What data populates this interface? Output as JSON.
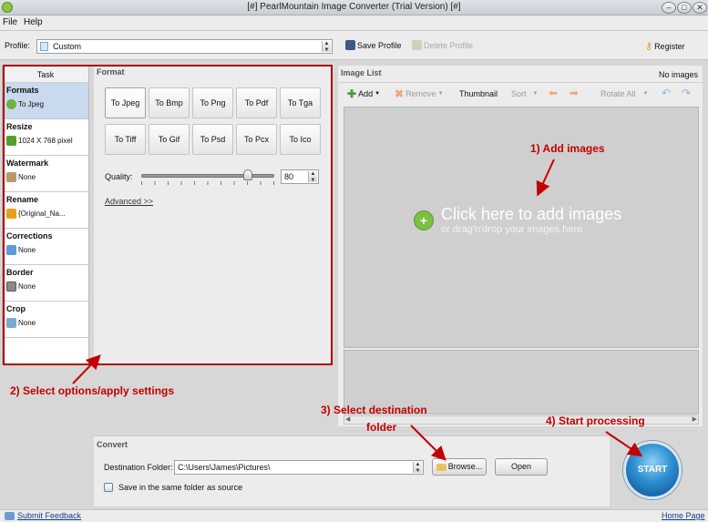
{
  "window": {
    "title": "[#] PearlMountain Image Converter (Trial Version) [#]"
  },
  "menu": {
    "file": "File",
    "help": "Help"
  },
  "profile": {
    "label": "Profile:",
    "value": "Custom",
    "save": "Save Profile",
    "delete": "Delete Profile",
    "register": "Register"
  },
  "task": {
    "header": "Task",
    "items": [
      {
        "title": "Formats",
        "value": "To Jpeg"
      },
      {
        "title": "Resize",
        "value": "1024 X 768 pixel"
      },
      {
        "title": "Watermark",
        "value": "None"
      },
      {
        "title": "Rename",
        "value": "{Original_Na..."
      },
      {
        "title": "Corrections",
        "value": "None"
      },
      {
        "title": "Border",
        "value": "None"
      },
      {
        "title": "Crop",
        "value": "None"
      }
    ]
  },
  "format": {
    "title": "Format",
    "buttons": [
      "To Jpeg",
      "To Bmp",
      "To Png",
      "To Pdf",
      "To Tga",
      "To Tiff",
      "To Gif",
      "To Psd",
      "To Pcx",
      "To Ico"
    ],
    "quality_label": "Quality:",
    "quality_value": "80",
    "quality_fraction": 0.8,
    "advanced": "Advanced >>"
  },
  "image_list": {
    "title": "Image List",
    "count": "No images",
    "toolbar": {
      "add": "Add",
      "remove": "Remove",
      "thumbnail": "Thumbnail",
      "sort": "Sort",
      "rotate_all": "Rotate All"
    },
    "click_here": "Click here  to add images",
    "drag_hint": "or drag'n'drop your images here"
  },
  "convert": {
    "title": "Convert",
    "dest_label": "Destination Folder:",
    "dest_value": "C:\\Users\\James\\Pictures\\",
    "browse": "Browse...",
    "open": "Open",
    "same_folder": "Save in the same folder as source",
    "start": "START"
  },
  "status": {
    "feedback": "Submit Feedback",
    "home": "Home Page"
  },
  "annotations": {
    "add_images": "1) Add images",
    "select_options": "2) Select options/apply settings",
    "dest_line1": "3) Select destination",
    "dest_line2": "folder",
    "start_processing": "4) Start processing"
  },
  "colors": {
    "annotation": "#c40000",
    "accent": "#2d8fd0",
    "selected_task": "#c9d9ee"
  }
}
